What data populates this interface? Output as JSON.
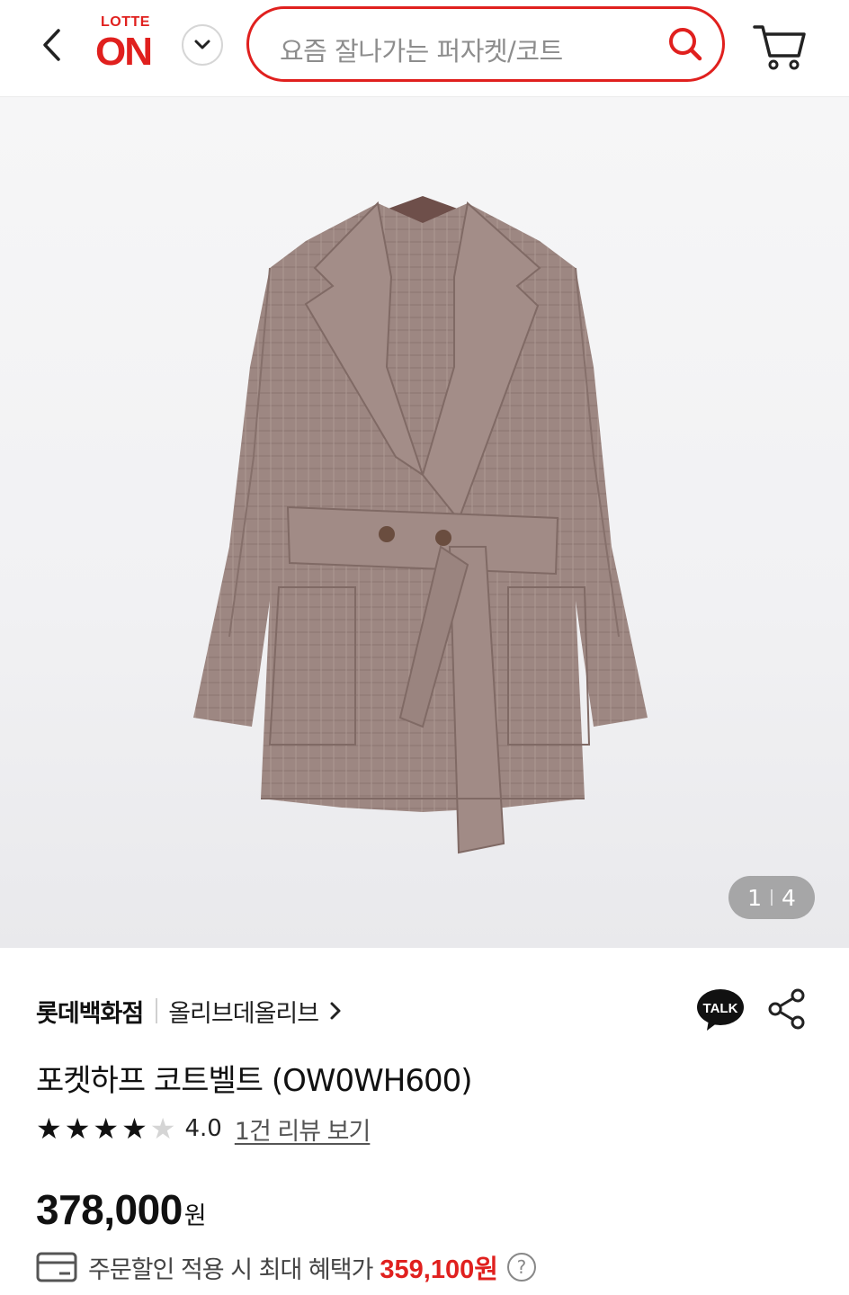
{
  "header": {
    "logo_top": "LOTTE",
    "logo_main": "ON",
    "search_placeholder": "요즘 잘나가는 퍼자켓/코트",
    "icons": [
      "back-arrow-icon",
      "chevron-down-icon",
      "search-icon",
      "cart-icon"
    ]
  },
  "gallery": {
    "current": "1",
    "total": "4"
  },
  "product": {
    "brand": "롯데백화점",
    "store": "올리브데올리브",
    "talk_label": "TALK",
    "title": "포켓하프 코트벨트 (OW0WH600)",
    "rating": {
      "stars_filled": 4,
      "stars_total": 5,
      "value": "4.0",
      "review_link": "1건 리뷰 보기"
    },
    "price": "378,000",
    "currency": "원",
    "benefit": {
      "text": "주문할인 적용 시 최대 혜택가",
      "price": "359,100원",
      "help": "?"
    }
  },
  "colors": {
    "accent": "#e0201e",
    "coat": "#9c8580"
  }
}
